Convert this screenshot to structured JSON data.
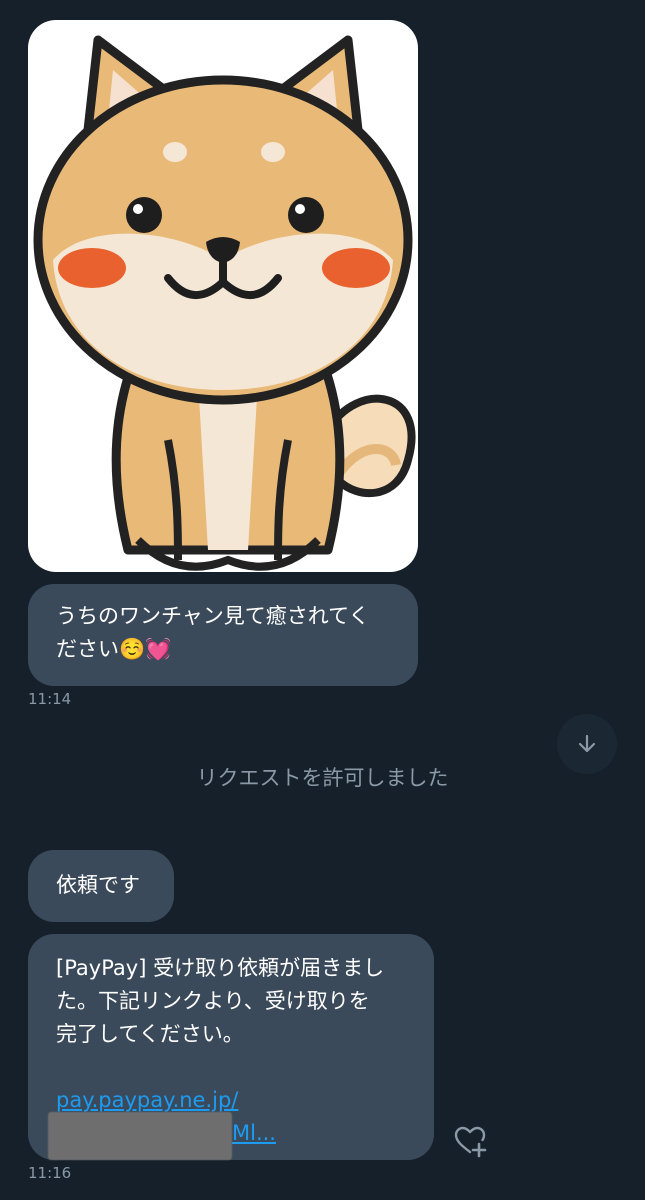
{
  "messages": [
    {
      "image_alt": "shiba-inu-illustration",
      "text": "うちのワンチャン見て癒されてください☺️💓",
      "time": "11:14"
    },
    {
      "text": "依頼です"
    },
    {
      "text_lines": [
        "[PayPay] 受け取り依頼が届きまし",
        "た。下記リンクより、受け取りを",
        "完了してください。"
      ],
      "link_line1": "pay.paypay.ne.jp/",
      "link_line2": "Ml...",
      "time": "11:16"
    }
  ],
  "system_message": "リクエストを許可しました",
  "icons": {
    "scroll_down": "arrow-down-icon",
    "react": "heart-plus-icon"
  },
  "colors": {
    "background": "#15202b",
    "bubble": "#3b4a5a",
    "link": "#1d9bf0",
    "muted": "#8b98a5"
  }
}
